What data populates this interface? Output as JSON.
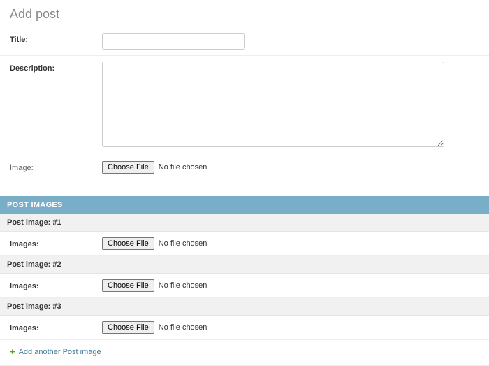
{
  "page": {
    "title": "Add post"
  },
  "fields": {
    "title": {
      "label": "Title:",
      "value": ""
    },
    "description": {
      "label": "Description:",
      "value": ""
    },
    "image": {
      "label": "Image:",
      "button": "Choose File",
      "status": "No file chosen"
    }
  },
  "inline": {
    "heading": "POST IMAGES",
    "items": [
      {
        "header": "Post image: #1",
        "label": "Images:",
        "button": "Choose File",
        "status": "No file chosen"
      },
      {
        "header": "Post image: #2",
        "label": "Images:",
        "button": "Choose File",
        "status": "No file chosen"
      },
      {
        "header": "Post image: #3",
        "label": "Images:",
        "button": "Choose File",
        "status": "No file chosen"
      }
    ],
    "add_another": "Add another Post image"
  }
}
